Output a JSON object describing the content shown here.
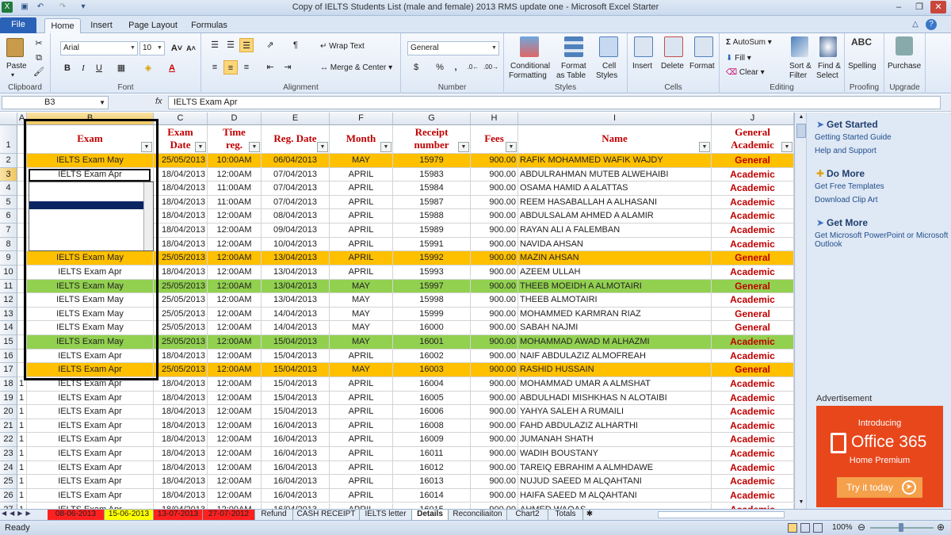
{
  "title_bar": {
    "title": "Copy of IELTS Students List (male and female) 2013 RMS update one  -  Microsoft Excel Starter"
  },
  "tabs": [
    "File",
    "Home",
    "Insert",
    "Page Layout",
    "Formulas"
  ],
  "ribbon": {
    "clipboard": {
      "label": "Clipboard",
      "paste": "Paste"
    },
    "font": {
      "label": "Font",
      "name": "Arial",
      "size": "10"
    },
    "alignment": {
      "label": "Alignment",
      "wrap": "Wrap Text",
      "merge": "Merge & Center"
    },
    "number": {
      "label": "Number",
      "format": "General"
    },
    "styles": {
      "label": "Styles",
      "conditional1": "Conditional",
      "conditional2": "Formatting",
      "format_as1": "Format",
      "format_as2": "as Table",
      "cell_styles1": "Cell",
      "cell_styles2": "Styles"
    },
    "cells": {
      "label": "Cells",
      "insert": "Insert",
      "delete": "Delete",
      "format": "Format"
    },
    "editing": {
      "label": "Editing",
      "autosum": "AutoSum",
      "fill": "Fill",
      "clear": "Clear",
      "sort1": "Sort &",
      "sort2": "Filter",
      "find1": "Find &",
      "find2": "Select"
    },
    "proofing": {
      "label": "Proofing",
      "spelling": "Spelling"
    },
    "upgrade": {
      "label": "Upgrade",
      "purchase": "Purchase"
    }
  },
  "formula_bar": {
    "cell_ref": "B3",
    "fx": "fx",
    "value": "IELTS Exam Apr"
  },
  "columns": [
    "A",
    "B",
    "C",
    "D",
    "E",
    "F",
    "G",
    "H",
    "I",
    "J"
  ],
  "headers": {
    "exam": "Exam",
    "exam_date1": "Exam",
    "exam_date2": "Date",
    "time1": "Time",
    "time2": "reg.",
    "reg_date": "Reg. Date",
    "month": "Month",
    "receipt1": "Receipt",
    "receipt2": "number",
    "fees": "Fees",
    "name": "Name",
    "gen1": "General",
    "gen2": "Academic"
  },
  "colors": {
    "orange": "#ffc000",
    "green": "#92d050",
    "header_red": "#c00000"
  },
  "rows": [
    {
      "n": "2",
      "a": "",
      "exam": "IELTS Exam May",
      "exam_date": "25/05/2013",
      "time": "10:00AM",
      "reg_date": "06/04/2013",
      "month": "MAY",
      "receipt": "15979",
      "fees": "900.00",
      "name": "RAFIK MOHAMMED WAFIK WAJDY",
      "type": "General",
      "hl": "orange"
    },
    {
      "n": "3",
      "a": "",
      "exam": "IELTS Exam Apr",
      "exam_date": "18/04/2013",
      "time": "12:00AM",
      "reg_date": "07/04/2013",
      "month": "APRIL",
      "receipt": "15983",
      "fees": "900.00",
      "name": "ABDULRAHMAN MUTEB ALWEHAIBI",
      "type": "Academic",
      "hl": ""
    },
    {
      "n": "4",
      "a": "",
      "exam": "",
      "exam_date": "18/04/2013",
      "time": "11:00AM",
      "reg_date": "07/04/2013",
      "month": "APRIL",
      "receipt": "15984",
      "fees": "900.00",
      "name": "OSAMA HAMID A ALATTAS",
      "type": "Academic",
      "hl": ""
    },
    {
      "n": "5",
      "a": "",
      "exam": "",
      "exam_date": "18/04/2013",
      "time": "11:00AM",
      "reg_date": "07/04/2013",
      "month": "APRIL",
      "receipt": "15987",
      "fees": "900.00",
      "name": "REEM HASABALLAH A ALHASANI",
      "type": "Academic",
      "hl": ""
    },
    {
      "n": "6",
      "a": "",
      "exam": "",
      "exam_date": "18/04/2013",
      "time": "12:00AM",
      "reg_date": "08/04/2013",
      "month": "APRIL",
      "receipt": "15988",
      "fees": "900.00",
      "name": "ABDULSALAM AHMED A ALAMIR",
      "type": "Academic",
      "hl": ""
    },
    {
      "n": "7",
      "a": "",
      "exam": "",
      "exam_date": "18/04/2013",
      "time": "12:00AM",
      "reg_date": "09/04/2013",
      "month": "APRIL",
      "receipt": "15989",
      "fees": "900.00",
      "name": "RAYAN ALI A FALEMBAN",
      "type": "Academic",
      "hl": ""
    },
    {
      "n": "8",
      "a": "",
      "exam": "",
      "exam_date": "18/04/2013",
      "time": "12:00AM",
      "reg_date": "10/04/2013",
      "month": "APRIL",
      "receipt": "15991",
      "fees": "900.00",
      "name": "NAVIDA AHSAN",
      "type": "Academic",
      "hl": ""
    },
    {
      "n": "9",
      "a": "",
      "exam": "IELTS Exam May",
      "exam_date": "25/05/2013",
      "time": "12:00AM",
      "reg_date": "13/04/2013",
      "month": "APRIL",
      "receipt": "15992",
      "fees": "900.00",
      "name": "MAZIN AHSAN",
      "type": "General",
      "hl": "orange"
    },
    {
      "n": "10",
      "a": "",
      "exam": "IELTS Exam Apr",
      "exam_date": "18/04/2013",
      "time": "12:00AM",
      "reg_date": "13/04/2013",
      "month": "APRIL",
      "receipt": "15993",
      "fees": "900.00",
      "name": "AZEEM ULLAH",
      "type": "Academic",
      "hl": ""
    },
    {
      "n": "11",
      "a": "",
      "exam": "IELTS Exam May",
      "exam_date": "25/05/2013",
      "time": "12:00AM",
      "reg_date": "13/04/2013",
      "month": "MAY",
      "receipt": "15997",
      "fees": "900.00",
      "name": "THEEB MOEIDH A ALMOTAIRI",
      "type": "General",
      "hl": "green"
    },
    {
      "n": "12",
      "a": "",
      "exam": "IELTS Exam May",
      "exam_date": "25/05/2013",
      "time": "12:00AM",
      "reg_date": "13/04/2013",
      "month": "MAY",
      "receipt": "15998",
      "fees": "900.00",
      "name": "THEEB ALMOTAIRI",
      "type": "Academic",
      "hl": ""
    },
    {
      "n": "13",
      "a": "",
      "exam": "IELTS Exam May",
      "exam_date": "25/05/2013",
      "time": "12:00AM",
      "reg_date": "14/04/2013",
      "month": "MAY",
      "receipt": "15999",
      "fees": "900.00",
      "name": "MOHAMMED KARMRAN RIAZ",
      "type": "General",
      "hl": ""
    },
    {
      "n": "14",
      "a": "",
      "exam": "IELTS Exam May",
      "exam_date": "25/05/2013",
      "time": "12:00AM",
      "reg_date": "14/04/2013",
      "month": "MAY",
      "receipt": "16000",
      "fees": "900.00",
      "name": "SABAH NAJMI",
      "type": "General",
      "hl": ""
    },
    {
      "n": "15",
      "a": "",
      "exam": "IELTS Exam May",
      "exam_date": "25/05/2013",
      "time": "12:00AM",
      "reg_date": "15/04/2013",
      "month": "MAY",
      "receipt": "16001",
      "fees": "900.00",
      "name": "MOHAMMAD AWAD M ALHAZMI",
      "type": "Academic",
      "hl": "green"
    },
    {
      "n": "16",
      "a": "",
      "exam": "IELTS Exam Apr",
      "exam_date": "18/04/2013",
      "time": "12:00AM",
      "reg_date": "15/04/2013",
      "month": "APRIL",
      "receipt": "16002",
      "fees": "900.00",
      "name": "NAIF ABDULAZIZ ALMOFREAH",
      "type": "Academic",
      "hl": ""
    },
    {
      "n": "17",
      "a": "",
      "exam": "IELTS Exam Apr",
      "exam_date": "25/05/2013",
      "time": "12:00AM",
      "reg_date": "15/04/2013",
      "month": "MAY",
      "receipt": "16003",
      "fees": "900.00",
      "name": "RASHID HUSSAIN",
      "type": "General",
      "hl": "orange"
    },
    {
      "n": "18",
      "a": "1",
      "exam": "IELTS Exam Apr",
      "exam_date": "18/04/2013",
      "time": "12:00AM",
      "reg_date": "15/04/2013",
      "month": "APRIL",
      "receipt": "16004",
      "fees": "900.00",
      "name": "MOHAMMAD UMAR A ALMSHAT",
      "type": "Academic",
      "hl": ""
    },
    {
      "n": "19",
      "a": "1",
      "exam": "IELTS Exam Apr",
      "exam_date": "18/04/2013",
      "time": "12:00AM",
      "reg_date": "15/04/2013",
      "month": "APRIL",
      "receipt": "16005",
      "fees": "900.00",
      "name": "ABDULHADI MISHKHAS N ALOTAIBI",
      "type": "Academic",
      "hl": ""
    },
    {
      "n": "20",
      "a": "1",
      "exam": "IELTS Exam Apr",
      "exam_date": "18/04/2013",
      "time": "12:00AM",
      "reg_date": "15/04/2013",
      "month": "APRIL",
      "receipt": "16006",
      "fees": "900.00",
      "name": "YAHYA SALEH A RUMAILI",
      "type": "Academic",
      "hl": ""
    },
    {
      "n": "21",
      "a": "1",
      "exam": "IELTS Exam Apr",
      "exam_date": "18/04/2013",
      "time": "12:00AM",
      "reg_date": "16/04/2013",
      "month": "APRIL",
      "receipt": "16008",
      "fees": "900.00",
      "name": "FAHD ABDULAZIZ ALHARTHI",
      "type": "Academic",
      "hl": ""
    },
    {
      "n": "22",
      "a": "1",
      "exam": "IELTS Exam Apr",
      "exam_date": "18/04/2013",
      "time": "12:00AM",
      "reg_date": "16/04/2013",
      "month": "APRIL",
      "receipt": "16009",
      "fees": "900.00",
      "name": "JUMANAH SHATH",
      "type": "Academic",
      "hl": ""
    },
    {
      "n": "23",
      "a": "1",
      "exam": "IELTS Exam Apr",
      "exam_date": "18/04/2013",
      "time": "12:00AM",
      "reg_date": "16/04/2013",
      "month": "APRIL",
      "receipt": "16011",
      "fees": "900.00",
      "name": "WADIH BOUSTANY",
      "type": "Academic",
      "hl": ""
    },
    {
      "n": "24",
      "a": "1",
      "exam": "IELTS Exam Apr",
      "exam_date": "18/04/2013",
      "time": "12:00AM",
      "reg_date": "16/04/2013",
      "month": "APRIL",
      "receipt": "16012",
      "fees": "900.00",
      "name": "TAREIQ EBRAHIM A ALMHDAWE",
      "type": "Academic",
      "hl": ""
    },
    {
      "n": "25",
      "a": "1",
      "exam": "IELTS Exam Apr",
      "exam_date": "18/04/2013",
      "time": "12:00AM",
      "reg_date": "16/04/2013",
      "month": "APRIL",
      "receipt": "16013",
      "fees": "900.00",
      "name": "NUJUD SAEED M ALQAHTANI",
      "type": "Academic",
      "hl": ""
    },
    {
      "n": "26",
      "a": "1",
      "exam": "IELTS Exam Apr",
      "exam_date": "18/04/2013",
      "time": "12:00AM",
      "reg_date": "16/04/2013",
      "month": "APRIL",
      "receipt": "16014",
      "fees": "900.00",
      "name": "HAIFA SAEED M ALQAHTANI",
      "type": "Academic",
      "hl": ""
    },
    {
      "n": "27",
      "a": "1",
      "exam": "IELTS Exam Apr",
      "exam_date": "18/04/2013",
      "time": "12:00AM",
      "reg_date": "16/04/2013",
      "month": "APRIL",
      "receipt": "16015",
      "fees": "900.00",
      "name": "AHMED WAQAS",
      "type": "Academic",
      "hl": ""
    },
    {
      "n": "28",
      "a": "1",
      "exam": "IELTS Exam Apr",
      "exam_date": "18/04/2013",
      "time": "12:00AM",
      "reg_date": "16/04/2013",
      "month": "APRIL",
      "receipt": "16016",
      "fees": "900.00",
      "name": "AMIR GHURAB",
      "type": "Academic",
      "hl": ""
    }
  ],
  "side_pane": {
    "get_started": "Get Started",
    "getting_started_guide": "Getting Started Guide",
    "help_support": "Help and Support",
    "do_more": "Do More",
    "free_templates": "Get Free Templates",
    "clip_art": "Download Clip Art",
    "get_more": "Get More",
    "get_ppt1": "Get Microsoft PowerPoint or Microsoft",
    "get_ppt2": "Outlook",
    "ad_label": "Advertisement",
    "ad_intro": "Introducing",
    "ad_product": "Office 365",
    "ad_edition": "Home Premium",
    "ad_cta": "Try it today"
  },
  "sheet_tabs": [
    {
      "label": "08-06-2013",
      "color": "#ff2020"
    },
    {
      "label": "15-06-2013",
      "color": "#ffff00"
    },
    {
      "label": "13-07-2013",
      "color": "#ff2020"
    },
    {
      "label": "27-07-2012",
      "color": "#ff2020"
    },
    {
      "label": "Refund",
      "color": ""
    },
    {
      "label": "CASH RECEIPT",
      "color": ""
    },
    {
      "label": "IELTS letter",
      "color": ""
    },
    {
      "label": "Details",
      "color": "active"
    },
    {
      "label": "Reconciliaiton",
      "color": ""
    },
    {
      "label": "Chart2",
      "color": ""
    },
    {
      "label": "Totals",
      "color": ""
    }
  ],
  "status": {
    "ready": "Ready",
    "zoom": "100%"
  }
}
